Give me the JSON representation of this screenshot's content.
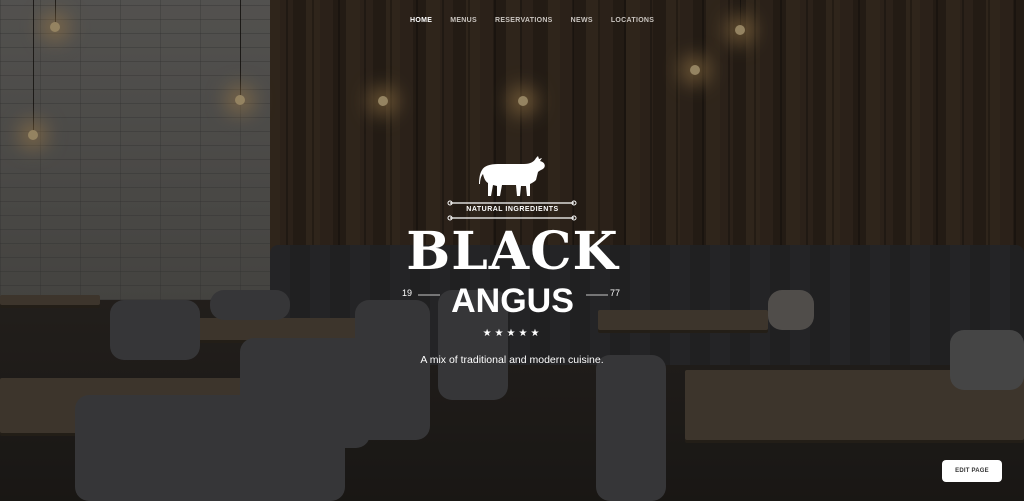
{
  "nav": {
    "items": [
      "HOME",
      "MENUS",
      "RESERVATIONS",
      "NEWS",
      "LOCATIONS"
    ]
  },
  "logo": {
    "icon": "cow-icon",
    "subtitle": "NATURAL INGREDIENTS",
    "name_line1": "BLACK",
    "name_line2": "ANGUS",
    "year_left": "19",
    "year_right": "77",
    "stars": "★★★★★",
    "rating_value": 5
  },
  "hero": {
    "tagline": "A mix of traditional and modern cuisine."
  },
  "edit_button": {
    "label": "EDIT PAGE"
  },
  "colors": {
    "text": "#ffffff",
    "nav_inactive": "#c9c4bf",
    "button_bg": "#ffffff"
  }
}
